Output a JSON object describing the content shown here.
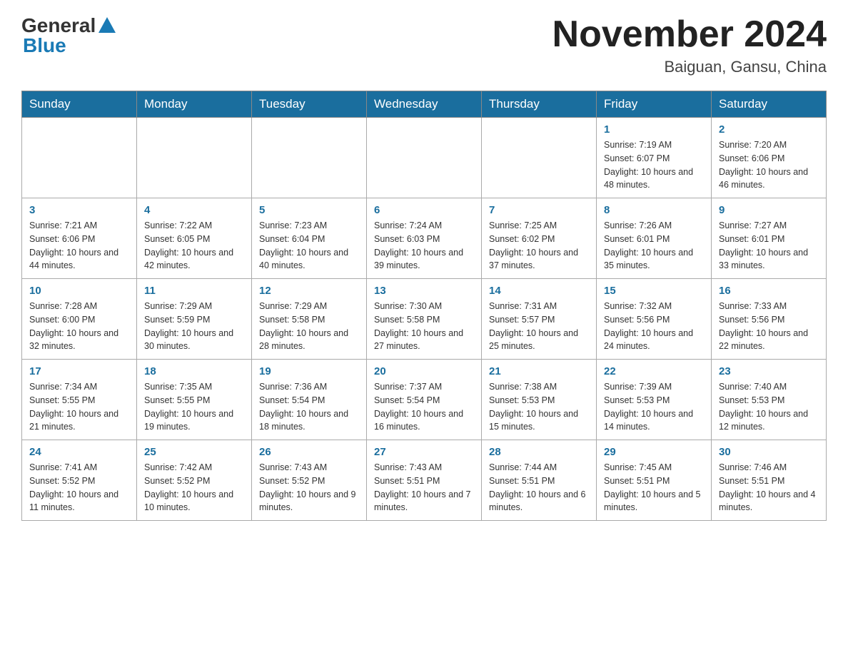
{
  "header": {
    "logo_general": "General",
    "logo_blue": "Blue",
    "month_title": "November 2024",
    "location": "Baiguan, Gansu, China"
  },
  "weekdays": [
    "Sunday",
    "Monday",
    "Tuesday",
    "Wednesday",
    "Thursday",
    "Friday",
    "Saturday"
  ],
  "weeks": [
    [
      {
        "day": "",
        "info": ""
      },
      {
        "day": "",
        "info": ""
      },
      {
        "day": "",
        "info": ""
      },
      {
        "day": "",
        "info": ""
      },
      {
        "day": "",
        "info": ""
      },
      {
        "day": "1",
        "info": "Sunrise: 7:19 AM\nSunset: 6:07 PM\nDaylight: 10 hours and 48 minutes."
      },
      {
        "day": "2",
        "info": "Sunrise: 7:20 AM\nSunset: 6:06 PM\nDaylight: 10 hours and 46 minutes."
      }
    ],
    [
      {
        "day": "3",
        "info": "Sunrise: 7:21 AM\nSunset: 6:06 PM\nDaylight: 10 hours and 44 minutes."
      },
      {
        "day": "4",
        "info": "Sunrise: 7:22 AM\nSunset: 6:05 PM\nDaylight: 10 hours and 42 minutes."
      },
      {
        "day": "5",
        "info": "Sunrise: 7:23 AM\nSunset: 6:04 PM\nDaylight: 10 hours and 40 minutes."
      },
      {
        "day": "6",
        "info": "Sunrise: 7:24 AM\nSunset: 6:03 PM\nDaylight: 10 hours and 39 minutes."
      },
      {
        "day": "7",
        "info": "Sunrise: 7:25 AM\nSunset: 6:02 PM\nDaylight: 10 hours and 37 minutes."
      },
      {
        "day": "8",
        "info": "Sunrise: 7:26 AM\nSunset: 6:01 PM\nDaylight: 10 hours and 35 minutes."
      },
      {
        "day": "9",
        "info": "Sunrise: 7:27 AM\nSunset: 6:01 PM\nDaylight: 10 hours and 33 minutes."
      }
    ],
    [
      {
        "day": "10",
        "info": "Sunrise: 7:28 AM\nSunset: 6:00 PM\nDaylight: 10 hours and 32 minutes."
      },
      {
        "day": "11",
        "info": "Sunrise: 7:29 AM\nSunset: 5:59 PM\nDaylight: 10 hours and 30 minutes."
      },
      {
        "day": "12",
        "info": "Sunrise: 7:29 AM\nSunset: 5:58 PM\nDaylight: 10 hours and 28 minutes."
      },
      {
        "day": "13",
        "info": "Sunrise: 7:30 AM\nSunset: 5:58 PM\nDaylight: 10 hours and 27 minutes."
      },
      {
        "day": "14",
        "info": "Sunrise: 7:31 AM\nSunset: 5:57 PM\nDaylight: 10 hours and 25 minutes."
      },
      {
        "day": "15",
        "info": "Sunrise: 7:32 AM\nSunset: 5:56 PM\nDaylight: 10 hours and 24 minutes."
      },
      {
        "day": "16",
        "info": "Sunrise: 7:33 AM\nSunset: 5:56 PM\nDaylight: 10 hours and 22 minutes."
      }
    ],
    [
      {
        "day": "17",
        "info": "Sunrise: 7:34 AM\nSunset: 5:55 PM\nDaylight: 10 hours and 21 minutes."
      },
      {
        "day": "18",
        "info": "Sunrise: 7:35 AM\nSunset: 5:55 PM\nDaylight: 10 hours and 19 minutes."
      },
      {
        "day": "19",
        "info": "Sunrise: 7:36 AM\nSunset: 5:54 PM\nDaylight: 10 hours and 18 minutes."
      },
      {
        "day": "20",
        "info": "Sunrise: 7:37 AM\nSunset: 5:54 PM\nDaylight: 10 hours and 16 minutes."
      },
      {
        "day": "21",
        "info": "Sunrise: 7:38 AM\nSunset: 5:53 PM\nDaylight: 10 hours and 15 minutes."
      },
      {
        "day": "22",
        "info": "Sunrise: 7:39 AM\nSunset: 5:53 PM\nDaylight: 10 hours and 14 minutes."
      },
      {
        "day": "23",
        "info": "Sunrise: 7:40 AM\nSunset: 5:53 PM\nDaylight: 10 hours and 12 minutes."
      }
    ],
    [
      {
        "day": "24",
        "info": "Sunrise: 7:41 AM\nSunset: 5:52 PM\nDaylight: 10 hours and 11 minutes."
      },
      {
        "day": "25",
        "info": "Sunrise: 7:42 AM\nSunset: 5:52 PM\nDaylight: 10 hours and 10 minutes."
      },
      {
        "day": "26",
        "info": "Sunrise: 7:43 AM\nSunset: 5:52 PM\nDaylight: 10 hours and 9 minutes."
      },
      {
        "day": "27",
        "info": "Sunrise: 7:43 AM\nSunset: 5:51 PM\nDaylight: 10 hours and 7 minutes."
      },
      {
        "day": "28",
        "info": "Sunrise: 7:44 AM\nSunset: 5:51 PM\nDaylight: 10 hours and 6 minutes."
      },
      {
        "day": "29",
        "info": "Sunrise: 7:45 AM\nSunset: 5:51 PM\nDaylight: 10 hours and 5 minutes."
      },
      {
        "day": "30",
        "info": "Sunrise: 7:46 AM\nSunset: 5:51 PM\nDaylight: 10 hours and 4 minutes."
      }
    ]
  ]
}
